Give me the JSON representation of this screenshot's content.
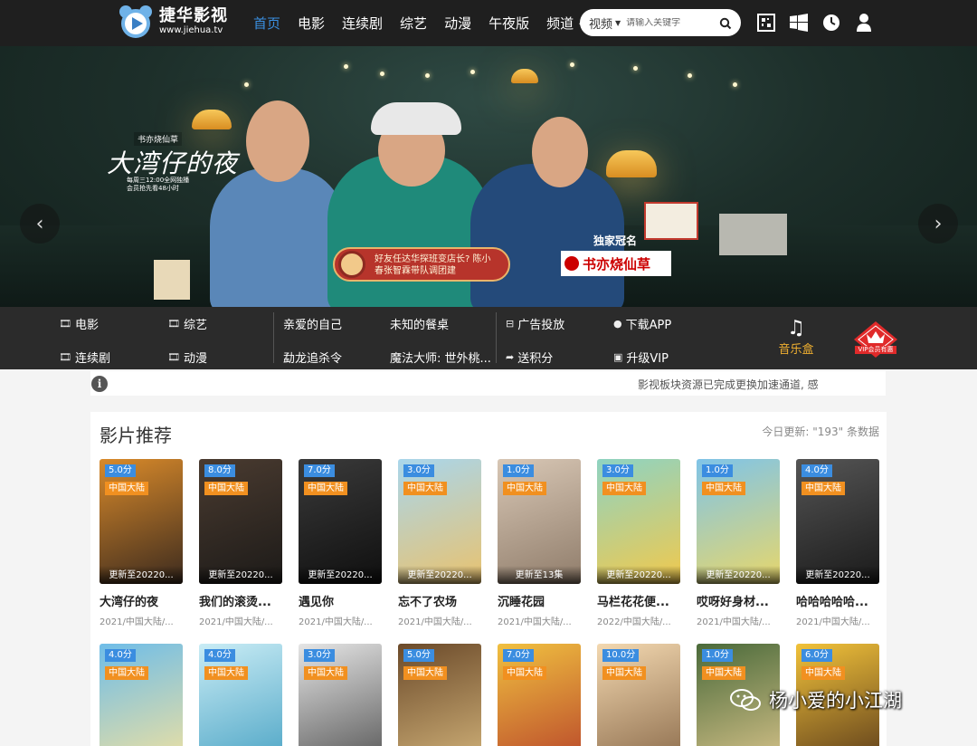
{
  "header": {
    "logo_cn": "捷华影视",
    "logo_en": "www.jiehua.tv",
    "nav": [
      {
        "label": "首页",
        "active": true
      },
      {
        "label": "电影"
      },
      {
        "label": "连续剧"
      },
      {
        "label": "综艺"
      },
      {
        "label": "动漫"
      },
      {
        "label": "午夜版"
      },
      {
        "label": "频道"
      }
    ],
    "search": {
      "category": "视频",
      "placeholder": "请输入关键字"
    },
    "icons": [
      "qr-app-icon",
      "windows-icon",
      "history-clock-icon",
      "user-icon"
    ]
  },
  "banner": {
    "sponsor": "书亦烧仙草",
    "title": "大湾仔的夜",
    "schedule": "每周三12:00全网独播 会员抢先看48小时",
    "caption": "好友任达华探班变店长? 陈小春张智霖带队调团建",
    "tag_prefix": "独家冠名",
    "tag_brand": "书亦烧仙草",
    "prev": "‹",
    "next": "›"
  },
  "quickbar": {
    "categories": [
      "电影",
      "综艺",
      "连续剧",
      "动漫"
    ],
    "hot": [
      "亲爱的自己",
      "未知的餐桌",
      "勐龙追杀令",
      "魔法大师: 世外桃..."
    ],
    "links": [
      "广告投放",
      "下载APP",
      "送积分",
      "升级VIP"
    ],
    "music": "音乐盒",
    "vip_badge": "VIP会员有惠"
  },
  "notice": {
    "message": "影视板块资源已完成更换加速通道, 感"
  },
  "recommend": {
    "title": "影片推荐",
    "update_text": "今日更新: \"193\" 条数据",
    "cards": [
      {
        "score": "5.0分",
        "region": "中国大陆",
        "update": "更新至20220...",
        "title": "大湾仔的夜",
        "meta": "2021/中国大陆/..."
      },
      {
        "score": "8.0分",
        "region": "中国大陆",
        "update": "更新至20220...",
        "title": "我们的滚烫...",
        "meta": "2021/中国大陆/..."
      },
      {
        "score": "7.0分",
        "region": "中国大陆",
        "update": "更新至20220...",
        "title": "遇见你",
        "meta": "2021/中国大陆/..."
      },
      {
        "score": "3.0分",
        "region": "中国大陆",
        "update": "更新至20220...",
        "title": "忘不了农场",
        "meta": "2021/中国大陆/..."
      },
      {
        "score": "1.0分",
        "region": "中国大陆",
        "update": "更新至13集",
        "title": "沉睡花园",
        "meta": "2021/中国大陆/..."
      },
      {
        "score": "3.0分",
        "region": "中国大陆",
        "update": "更新至20220...",
        "title": "马栏花花便...",
        "meta": "2022/中国大陆/..."
      },
      {
        "score": "1.0分",
        "region": "中国大陆",
        "update": "更新至20220...",
        "title": "哎呀好身材...",
        "meta": "2021/中国大陆/..."
      },
      {
        "score": "4.0分",
        "region": "中国大陆",
        "update": "更新至20220...",
        "title": "哈哈哈哈哈...",
        "meta": "2021/中国大陆/..."
      },
      {
        "score": "4.0分",
        "region": "中国大陆"
      },
      {
        "score": "4.0分",
        "region": "中国大陆"
      },
      {
        "score": "3.0分",
        "region": "中国大陆"
      },
      {
        "score": "5.0分",
        "region": "中国大陆"
      },
      {
        "score": "7.0分",
        "region": "中国大陆"
      },
      {
        "score": "10.0分",
        "region": "中国大陆"
      },
      {
        "score": "1.0分",
        "region": "中国大陆"
      },
      {
        "score": "6.0分",
        "region": "中国大陆"
      }
    ]
  },
  "watermark": {
    "text": "杨小爱的小江湖"
  },
  "colors": {
    "accent": "#3a8fe0",
    "score_bg": "#3b8de0",
    "region_bg": "#f19020",
    "header_bg": "#1f1f1f",
    "quickbar_bg": "#2b2b2b"
  }
}
